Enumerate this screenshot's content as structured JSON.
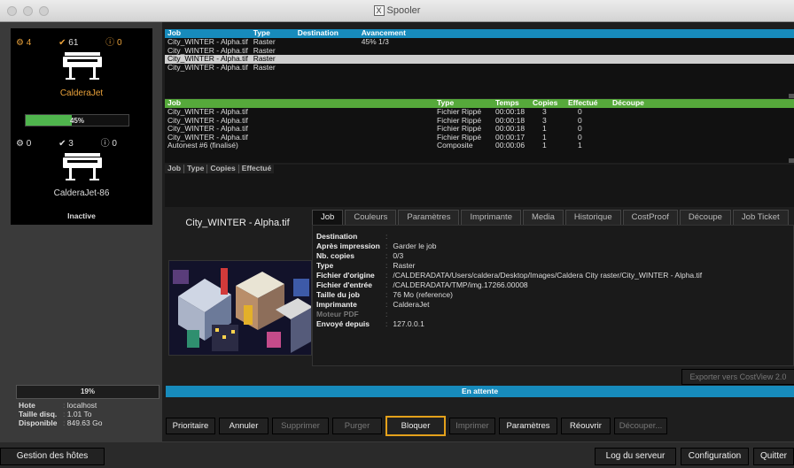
{
  "window": {
    "title": "Spooler"
  },
  "printers": [
    {
      "name": "CalderaJet",
      "stats": {
        "processing": "4",
        "done": "61",
        "errors": "0"
      },
      "progress_label": "45%",
      "progress": 0.45,
      "status": ""
    },
    {
      "name": "CalderaJet-86",
      "stats": {
        "processing": "0",
        "done": "3",
        "errors": "0"
      },
      "progress_label": "",
      "progress": 0,
      "status": "Inactive"
    }
  ],
  "disk": {
    "percent_label": "19%",
    "percent": 0.19
  },
  "host": {
    "host_label": "Hote",
    "host_value": "localhost",
    "size_label": "Taille disq.",
    "size_value": "1.01 To",
    "avail_label": "Disponible",
    "avail_value": "849.63 Go"
  },
  "queue1": {
    "headers": [
      "Job",
      "Type",
      "Destination",
      "Avancement"
    ],
    "rows": [
      [
        "City_WINTER - Alpha.tif",
        "Raster",
        "",
        "45% 1/3"
      ],
      [
        "City_WINTER - Alpha.tif",
        "Raster",
        "",
        ""
      ],
      [
        "City_WINTER - Alpha.tif",
        "Raster",
        "",
        ""
      ],
      [
        "City_WINTER - Alpha.tif",
        "Raster",
        "",
        ""
      ]
    ]
  },
  "queue2": {
    "headers": [
      "Job",
      "Type",
      "Temps",
      "Copies",
      "Effectué",
      "Découpe"
    ],
    "rows": [
      [
        "City_WINTER - Alpha.tif",
        "Fichier Rippé",
        "00:00:18",
        "3",
        "0",
        ""
      ],
      [
        "City_WINTER - Alpha.tif",
        "Fichier Rippé",
        "00:00:18",
        "3",
        "0",
        ""
      ],
      [
        "City_WINTER - Alpha.tif",
        "Fichier Rippé",
        "00:00:18",
        "1",
        "0",
        ""
      ],
      [
        "City_WINTER - Alpha.tif",
        "Fichier Rippé",
        "00:00:17",
        "1",
        "0",
        ""
      ],
      [
        "Autonest #6 (finalisé)",
        "Composite",
        "00:00:06",
        "1",
        "1",
        ""
      ]
    ]
  },
  "queue3": {
    "headers": [
      "Job",
      "Type",
      "Copies",
      "Effectué"
    ]
  },
  "detail": {
    "job_name": "City_WINTER - Alpha.tif",
    "tabs": [
      "Job",
      "Couleurs",
      "Paramètres",
      "Imprimante",
      "Media",
      "Historique",
      "CostProof",
      "Découpe",
      "Job Ticket"
    ],
    "fields": [
      {
        "label": "Destination",
        "value": ""
      },
      {
        "label": "Après impression",
        "value": "Garder le job"
      },
      {
        "label": "Nb. copies",
        "value": "0/3"
      },
      {
        "label": "Type",
        "value": "Raster"
      },
      {
        "label": "Fichier d'origine",
        "value": "/CALDERADATA/Users/caldera/Desktop/Images/Caldera City raster/City_WINTER - Alpha.tif"
      },
      {
        "label": "Fichier d'entrée",
        "value": "/CALDERADATA/TMP/img.17266.00008"
      },
      {
        "label": "Taille du job",
        "value": "76 Mo (reference)"
      },
      {
        "label": "Imprimante",
        "value": "CalderaJet"
      },
      {
        "label": "Moteur PDF",
        "value": ""
      },
      {
        "label": "Envoyé depuis",
        "value": "127.0.0.1"
      }
    ],
    "export_button": "Exporter vers CostView 2.0"
  },
  "status": "En attente",
  "actions": [
    "Prioritaire",
    "Annuler",
    "Supprimer",
    "Purger",
    "Bloquer",
    "Imprimer",
    "Paramètres",
    "Réouvrir",
    "Découper..."
  ],
  "bottom": {
    "hosts": "Gestion des hôtes",
    "log": "Log du serveur",
    "config": "Configuration",
    "quit": "Quitter"
  },
  "colors": {
    "accent_blue": "#178bbc",
    "accent_green": "#56a93b",
    "progress_green": "#4fb54d",
    "focus_orange": "#e4a11b",
    "icon_orange": "#e9a13a"
  }
}
